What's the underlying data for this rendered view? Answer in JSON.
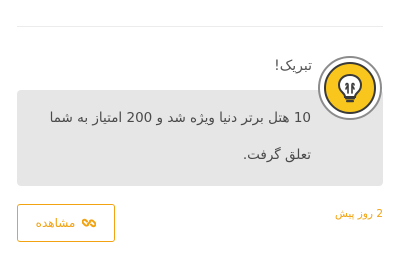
{
  "notification": {
    "title": "تبریک!",
    "message": "10 هتل برتر دنیا ویژه شد و 200 امتیاز به شما تعلق گرفت.",
    "time": "2 روز پیش",
    "button_label": "مشاهده",
    "icon": "lightbulb-icon",
    "button_icon": "link-icon"
  },
  "colors": {
    "accent": "#f2a312",
    "message_bg": "#e6e6e6",
    "avatar_fill": "#f8c61c"
  }
}
